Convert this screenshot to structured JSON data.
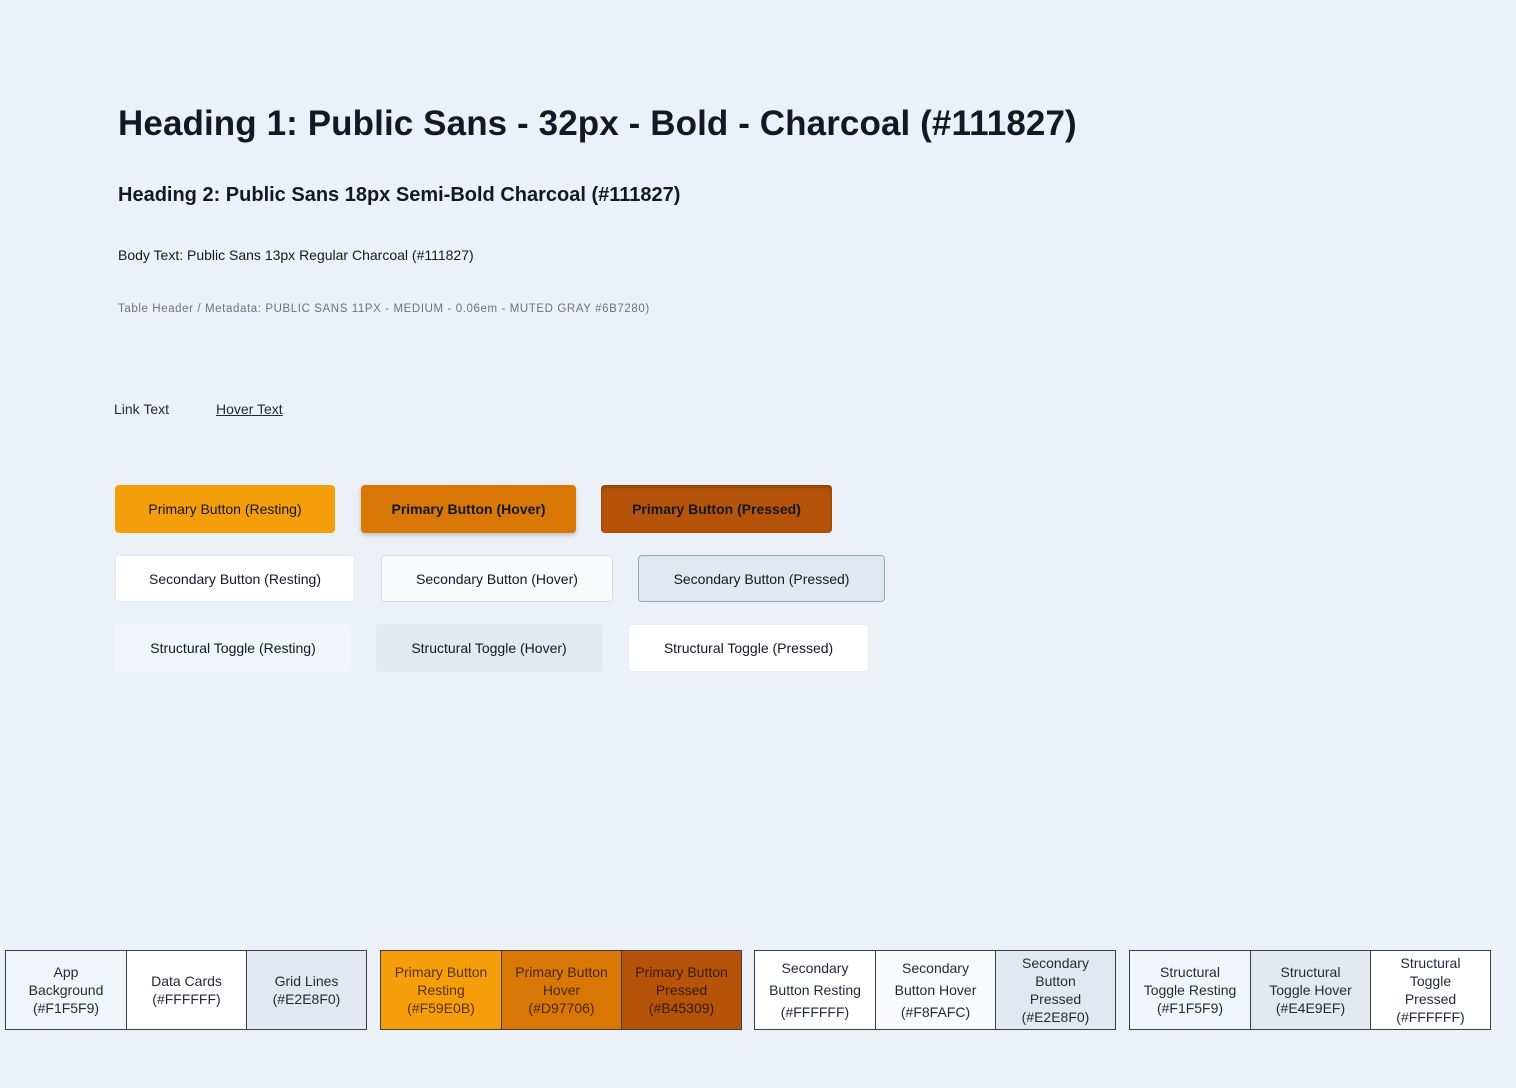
{
  "typography": {
    "heading1": "Heading 1: Public Sans - 32px - Bold - Charcoal (#111827)",
    "heading2": "Heading 2: Public Sans 18px Semi-Bold Charcoal (#111827)",
    "body": "Body Text: Public Sans 13px Regular Charcoal (#111827)",
    "metadata": "Table Header / Metadata: PUBLIC SANS 11PX - MEDIUM - 0.06em - MUTED GRAY #6B7280)"
  },
  "links": {
    "link_text": "Link Text",
    "hover_text": "Hover Text"
  },
  "buttons": {
    "primary": {
      "resting": "Primary Button (Resting)",
      "hover": "Primary Button (Hover)",
      "pressed": "Primary Button (Pressed)"
    },
    "secondary": {
      "resting": "Secondary Button (Resting)",
      "hover": "Secondary Button (Hover)",
      "pressed": "Secondary Button (Pressed)"
    },
    "toggle": {
      "resting": "Structural Toggle (Resting)",
      "hover": "Structural Toggle (Hover)",
      "pressed": "Structural Toggle (Pressed)"
    }
  },
  "swatches": {
    "surfaces": [
      {
        "label": "App\nBackground\n(#F1F5F9)",
        "color": "#F1F5F9"
      },
      {
        "label": "Data Cards\n(#FFFFFF)",
        "color": "#FFFFFF"
      },
      {
        "label": "Grid Lines\n(#E2E8F0)",
        "color": "#E2E8F0"
      }
    ],
    "primary": [
      {
        "label": "Primary Button\nResting\n(#F59E0B)",
        "color": "#F59E0B"
      },
      {
        "label": "Primary Button\nHover\n(#D97706)",
        "color": "#D97706"
      },
      {
        "label": "Primary Button\nPressed\n(#B45309)",
        "color": "#B45309"
      }
    ],
    "secondary": [
      {
        "label": "Secondary\nButton Resting\n(#FFFFFF)",
        "color": "#FFFFFF"
      },
      {
        "label": "Secondary\nButton Hover\n(#F8FAFC)",
        "color": "#F8FAFC"
      },
      {
        "label": "Secondary\nButton\nPressed\n(#E2E8F0)",
        "color": "#E2E8F0"
      }
    ],
    "toggle": [
      {
        "label": "Structural\nToggle Resting\n(#F1F5F9)",
        "color": "#F1F5F9"
      },
      {
        "label": "Structural\nToggle Hover\n(#E4E9EF)",
        "color": "#E4E9EF"
      },
      {
        "label": "Structural\nToggle\nPressed\n(#FFFFFF)",
        "color": "#FFFFFF"
      }
    ]
  }
}
